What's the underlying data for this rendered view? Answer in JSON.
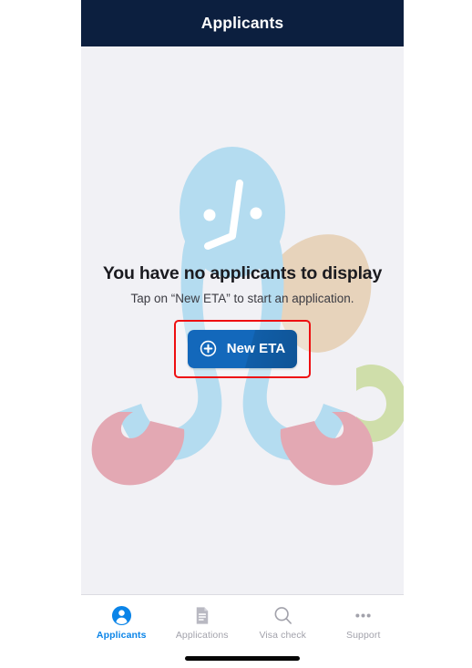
{
  "header": {
    "title": "Applicants",
    "background_color": "#0c1f3f",
    "text_color": "#ffffff"
  },
  "empty_state": {
    "title": "You have no applicants to display",
    "subtitle": "Tap on “New ETA” to start an application.",
    "cta": {
      "label": "New ETA",
      "icon": "plus-circle-icon",
      "background_color": "#1368bb",
      "text_color": "#ffffff"
    },
    "highlight": {
      "color": "#ee0f11",
      "shape": "rectangle"
    }
  },
  "illustration": {
    "name": "empty-applicants-illustration",
    "colors": {
      "character": "#b4dcf0",
      "feet": "#e3a8b3",
      "blob_tan": "#e7d3bb",
      "blob_green": "#cfdeaa",
      "face": "#ffffff"
    }
  },
  "tabbar": {
    "active_color": "#0a84e8",
    "inactive_color": "#a2a2ab",
    "items": [
      {
        "label": "Applicants",
        "icon": "person-circle-icon",
        "active": true
      },
      {
        "label": "Applications",
        "icon": "document-icon",
        "active": false
      },
      {
        "label": "Visa check",
        "icon": "search-icon",
        "active": false
      },
      {
        "label": "Support",
        "icon": "ellipsis-icon",
        "active": false
      }
    ]
  },
  "system": {
    "home_indicator": "home-indicator-bar"
  }
}
